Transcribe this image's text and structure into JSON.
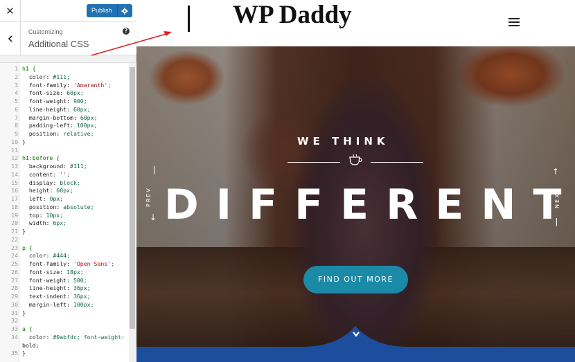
{
  "topbar": {
    "close_icon": "close-icon",
    "publish_label": "Publish",
    "settings_icon": "gear-icon"
  },
  "section": {
    "customizing_label": "Customizing",
    "title": "Additional CSS",
    "help_icon": "help-icon"
  },
  "editor": {
    "lines": [
      "h1 {",
      "  color: #111;",
      "  font-family: 'Amaranth';",
      "  font-size: 60px;",
      "  font-weight: 900;",
      "  line-height: 60px;",
      "  margin-bottom: 60px;",
      "  padding-left: 100px;",
      "  position: relative;",
      "}",
      "",
      "h1:before {",
      "  background: #111;",
      "  content: '';",
      "  display: block;",
      "  height: 60px;",
      "  left: 0px;",
      "  position: absolute;",
      "  top: 10px;",
      "  width: 6px;",
      "}",
      "",
      "p {",
      "  color: #444;",
      "  font-family: 'Open Sans';",
      "  font-size: 18px;",
      "  font-weight: 500;",
      "  line-height: 36px;",
      "  text-indent: 36px;",
      "  margin-left: 100px;",
      "}",
      "",
      "a {",
      "  color: #0abfdc; font-weight:",
      "bold;",
      "}"
    ],
    "line_numbers": [
      "1",
      "2",
      "3",
      "4",
      "5",
      "6",
      "7",
      "8",
      "9",
      "10",
      "11",
      "12",
      "13",
      "14",
      "15",
      "16",
      "17",
      "18",
      "19",
      "20",
      "21",
      "22",
      "23",
      "24",
      "25",
      "26",
      "27",
      "28",
      "29",
      "30",
      "31",
      "32",
      "33",
      "34",
      "",
      "35"
    ]
  },
  "preview": {
    "site_title": "WP Daddy",
    "menu_icon": "hamburger-menu-icon",
    "hero": {
      "eyebrow": "WE THINK",
      "cup_icon": "coffee-cup-icon",
      "headline": "DIFFERENT",
      "prev_label": "PREV",
      "next_label": "NEXT",
      "cta_label": "FIND OUT MORE",
      "down_icon": "chevron-down-icon"
    }
  },
  "colors": {
    "publish": "#2271b1",
    "cta": "#1b8aa6",
    "wave": "#1d4e9e",
    "annotation": "#e02020"
  }
}
